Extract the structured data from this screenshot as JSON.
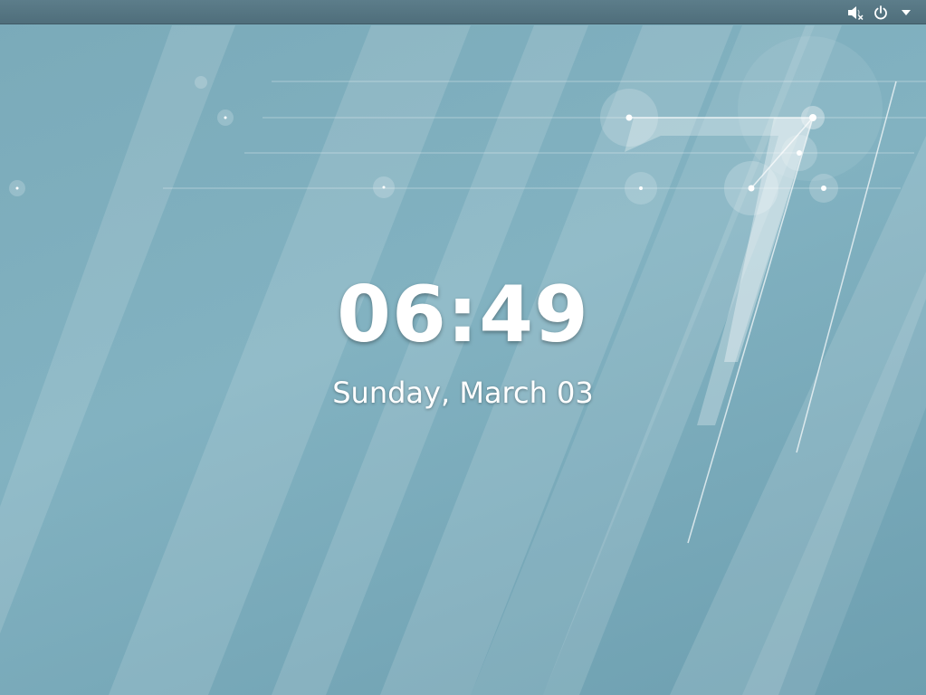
{
  "lock_screen": {
    "time": "06:49",
    "date": "Sunday, March 03"
  },
  "top_bar": {
    "icons": [
      "volume-muted-icon",
      "power-icon",
      "dropdown-arrow-icon"
    ]
  },
  "colors": {
    "background": "#7aaab9",
    "top_bar": "#56747f",
    "text": "#ffffff"
  }
}
